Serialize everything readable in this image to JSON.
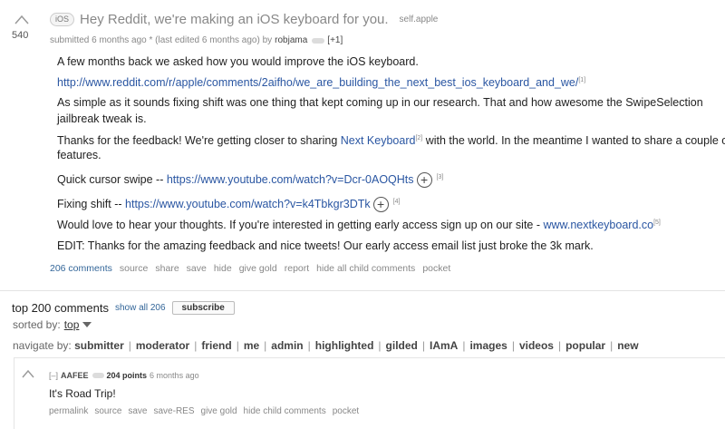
{
  "post": {
    "score": "540",
    "flair": "iOS",
    "title": "Hey Reddit, we're making an iOS keyboard for you.",
    "domain": "self.apple",
    "tagline": {
      "submitted": "submitted 6 months ago",
      "edited": "* (last edited 6 months ago)",
      "by": "by",
      "author": "robjama",
      "karma": "[+1]"
    },
    "body": {
      "p1": "A few months back we asked how you would improve the iOS keyboard.",
      "p2_link": "http://www.reddit.com/r/apple/comments/2aifho/we_are_building_the_next_best_ios_keyboard_and_we/",
      "p2_sup": "[1]",
      "p3a": "As simple as it sounds fixing shift was one thing that kept coming up in our research. That and how awesome the SwipeSelection",
      "p3b": "jailbreak tweak is.",
      "p4a_pre": "Thanks for the feedback! We're getting closer to sharing ",
      "p4a_link": "Next Keyboard",
      "p4a_sup": "[2]",
      "p4a_post": " with the world. In the meantime I wanted to share a couple of",
      "p4b": "features.",
      "p5_label": "Quick cursor swipe -- ",
      "p5_link": "https://www.youtube.com/watch?v=Dcr-0AOQHts",
      "p5_sup": "[3]",
      "p6_label": "Fixing shift -- ",
      "p6_link": "https://www.youtube.com/watch?v=k4Tbkgr3DTk",
      "p6_sup": "[4]",
      "p7_pre": "Would love to hear your thoughts. If you're interested in getting early access sign up on our site - ",
      "p7_link": "www.nextkeyboard.co",
      "p7_sup": "[5]",
      "p8": "EDIT: Thanks for the amazing feedback and nice tweets! Our early access email list just broke the 3k mark."
    },
    "buttons": [
      "206 comments",
      "source",
      "share",
      "save",
      "hide",
      "give gold",
      "report",
      "hide all child comments",
      "pocket"
    ]
  },
  "comments_area": {
    "title": "top 200 comments",
    "show_all": "show all 206",
    "subscribe": "subscribe",
    "sorted_by_label": "sorted by:",
    "sorted_by_value": "top",
    "navigate_label": "navigate by:",
    "navigate_options": [
      "submitter",
      "moderator",
      "friend",
      "me",
      "admin",
      "highlighted",
      "gilded",
      "IAmA",
      "images",
      "videos",
      "popular",
      "new"
    ]
  },
  "comment": {
    "expand": "[–]",
    "author": "AAFEE",
    "points": "204 points",
    "time": "6 months ago",
    "text": "It's Road Trip!",
    "buttons": [
      "permalink",
      "source",
      "save",
      "save-RES",
      "give gold",
      "hide child comments",
      "pocket"
    ]
  }
}
